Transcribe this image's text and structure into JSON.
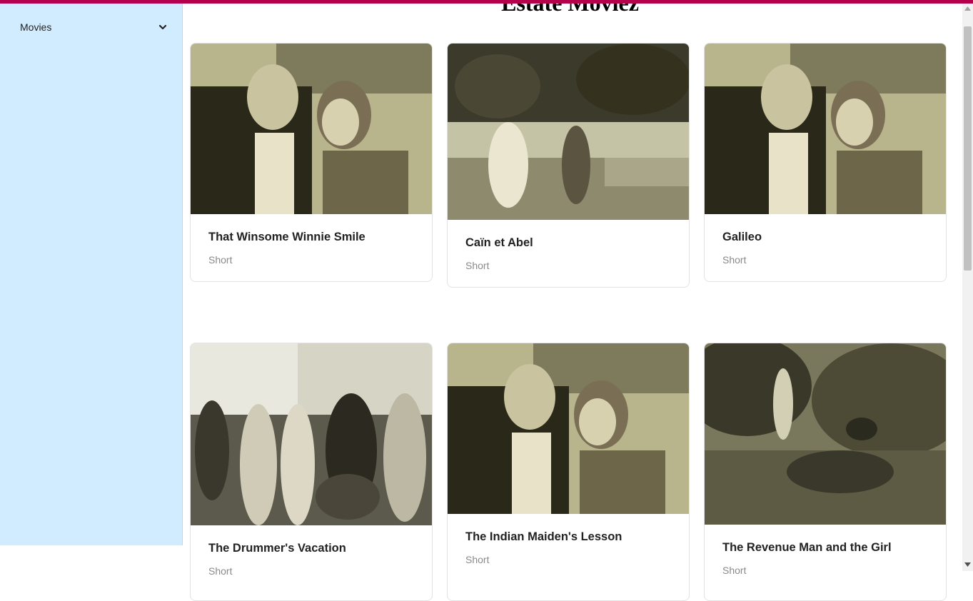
{
  "app": {
    "title": "Estate Moviez"
  },
  "sidebar": {
    "items": [
      {
        "label": "Movies",
        "icon": "chevron-down-icon"
      }
    ]
  },
  "movies": [
    {
      "title": "That Winsome Winnie Smile",
      "genre": "Short",
      "image": "man-woman-portrait-photo"
    },
    {
      "title": "Caïn et Abel",
      "genre": "Short",
      "image": "two-figures-rocky-landscape-photo"
    },
    {
      "title": "Galileo",
      "genre": "Short",
      "image": "man-woman-portrait-photo"
    },
    {
      "title": "The Drummer's Vacation",
      "genre": "Short",
      "image": "group-outdoor-photo"
    },
    {
      "title": "The Indian Maiden's Lesson",
      "genre": "Short",
      "image": "man-woman-portrait-photo"
    },
    {
      "title": "The Revenue Man and the Girl",
      "genre": "Short",
      "image": "man-lying-in-grass-photo"
    }
  ],
  "colors": {
    "accent_bar": "#b5004e",
    "sidebar_bg": "#d2ecff",
    "photo_sepia": "#2f2b1f"
  }
}
